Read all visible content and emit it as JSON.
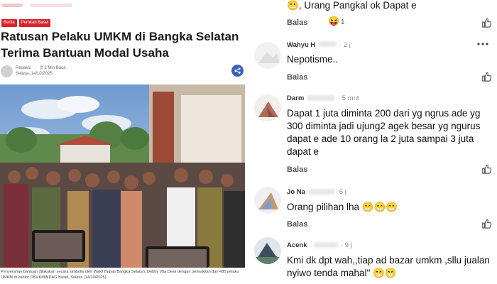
{
  "article": {
    "tags": [
      "Berita",
      "Pemkab Basel"
    ],
    "headline": "Ratusan Pelaku UMKM di Bangka Selatan Terima Bantuan Modal Usaha",
    "author": "Redaksi",
    "read_time": "2 Min Baca",
    "date": "Selasa, 14/10/2025",
    "caption": "Penyerahan bantuan dilakukan secara simbolis oleh Wakil Bupati Bangka Selatan, Debby Vita Dewi dengan perwakilan dari 430 pelaku UMKM di kantor DKUKMINDAG Basel, Selasa (14/10/2025)."
  },
  "comments": {
    "top_partial": {
      "text": "Urang Pangkal ok Dapat e",
      "prefix": "😬,",
      "reply_label": "Balas",
      "reaction_emoji": "😝",
      "reaction_count": "1"
    },
    "items": [
      {
        "name": "Wahyu H",
        "time": "· 2 j",
        "text": "Nepotisme..",
        "reply_label": "Balas"
      },
      {
        "name": "Darm",
        "time": "· 5 mnt",
        "text": "Dapat 1 juta diminta 200 dari yg ngrus ade yg 300 diminta jadi ujung2 agek besar yg ngurus dapat e ade 10 orang la 2 juta sampai 3 juta dapat e",
        "reply_label": "Balas"
      },
      {
        "name": "Jo Na",
        "time": "· 6 j",
        "text": "Orang pilihan lha 😁😁😁",
        "reply_label": "Balas"
      },
      {
        "name": "Acenk",
        "time": "· 9 j",
        "text": "Kmi dk dpt wah,,tiap ad bazar umkm ,sllu jualan nyiwo tenda mahal\" 😁😁"
      }
    ]
  },
  "colors": {
    "tag_red": "#d6262a",
    "share_blue": "#3a63b8"
  }
}
